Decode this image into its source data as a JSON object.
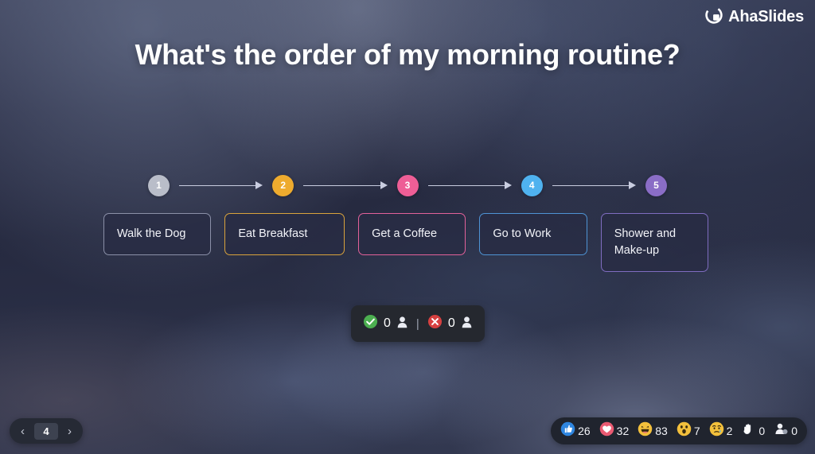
{
  "brand": {
    "name": "AhaSlides",
    "logo_icon": "ahaslides-logo-icon"
  },
  "slide": {
    "title": "What's the order of my morning routine?"
  },
  "timeline": {
    "steps": [
      {
        "number": "1",
        "color": "#b9bdc9"
      },
      {
        "number": "2",
        "color": "#eeab2e"
      },
      {
        "number": "3",
        "color": "#ee5e96"
      },
      {
        "number": "4",
        "color": "#4fb2ef"
      },
      {
        "number": "5",
        "color": "#8a6dc6"
      }
    ],
    "arrow_color": "#c9cde0"
  },
  "answers": [
    {
      "label": "Walk the Dog",
      "border": "#8b90a8"
    },
    {
      "label": "Eat Breakfast",
      "border": "#d9a33c"
    },
    {
      "label": "Get a Coffee",
      "border": "#e2619a"
    },
    {
      "label": "Go to Work",
      "border": "#4e93d4"
    },
    {
      "label": "Shower and Make-up",
      "border": "#7f6cc0"
    }
  ],
  "votes": {
    "correct_icon": "check-circle-icon",
    "correct_count": "0",
    "correct_person_icon": "person-icon",
    "separator": "|",
    "incorrect_icon": "x-circle-icon",
    "incorrect_count": "0",
    "incorrect_person_icon": "person-icon",
    "correct_color": "#4caf50",
    "incorrect_color": "#d64040"
  },
  "pager": {
    "prev_icon": "chevron-left-icon",
    "page": "4",
    "next_icon": "chevron-right-icon"
  },
  "reactions": [
    {
      "icon": "thumbs-up-icon",
      "count": "26"
    },
    {
      "icon": "heart-icon",
      "count": "32"
    },
    {
      "icon": "laughing-face-icon",
      "count": "83"
    },
    {
      "icon": "surprised-face-icon",
      "count": "7"
    },
    {
      "icon": "sad-face-icon",
      "count": "2"
    },
    {
      "icon": "raised-hand-icon",
      "count": "0"
    },
    {
      "icon": "person-icon",
      "count": "0"
    }
  ]
}
